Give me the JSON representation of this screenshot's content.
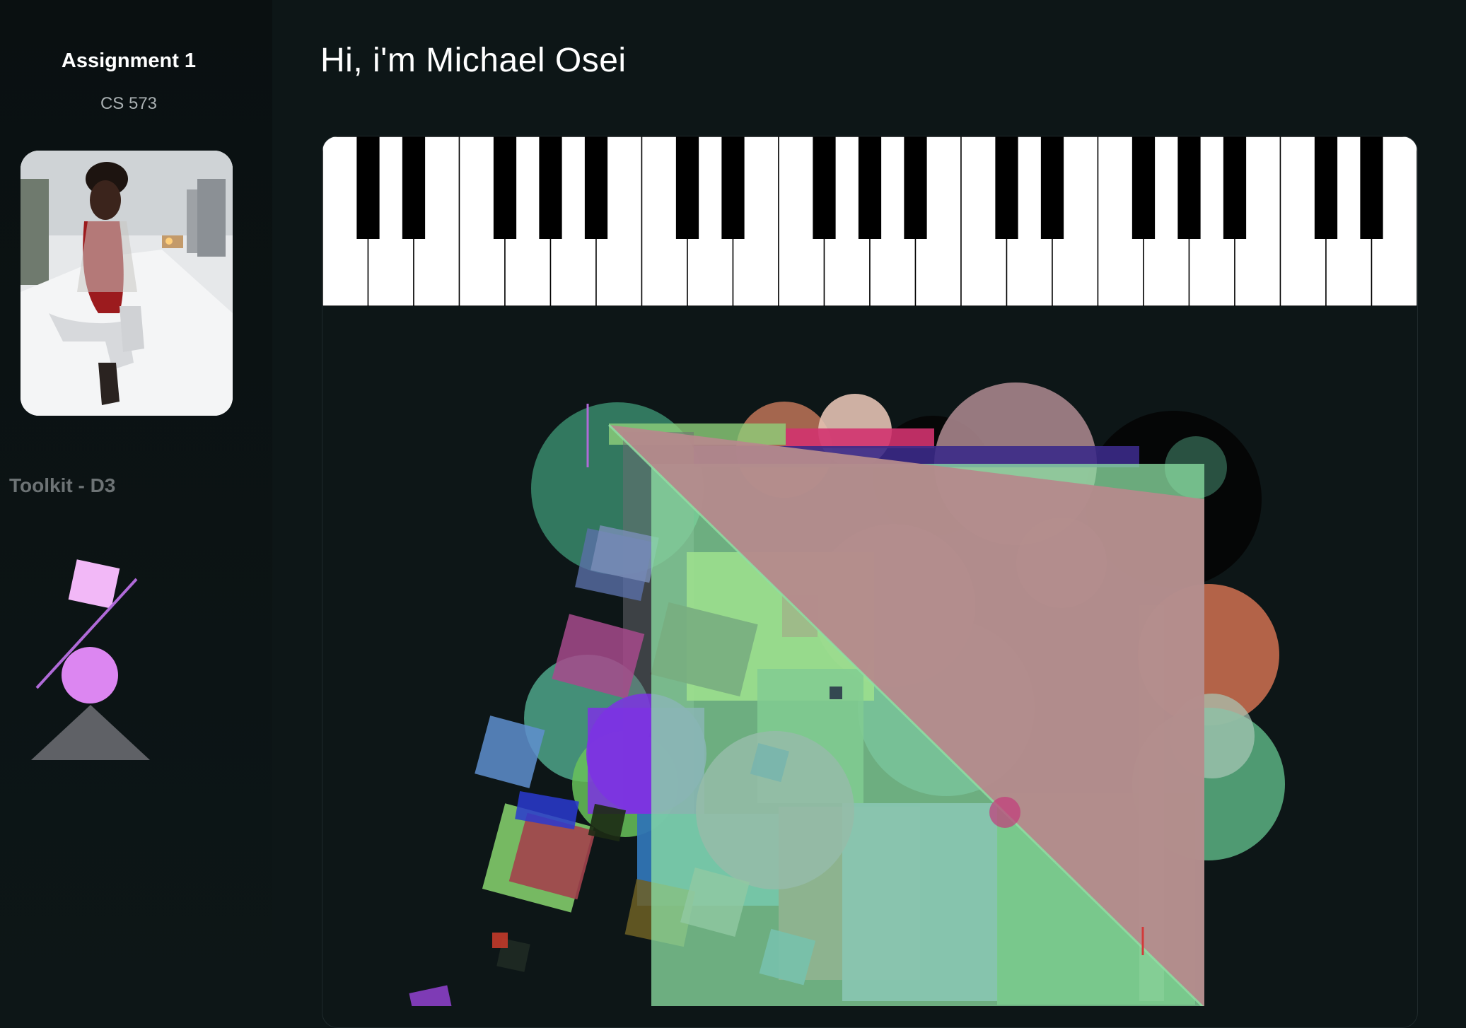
{
  "sidebar": {
    "title": "Assignment 1",
    "subtitle": "CS 573",
    "section_label": "Toolkit - D3"
  },
  "main": {
    "heading": "Hi, i'm Michael Osei"
  },
  "piano": {
    "white_key_count": 24,
    "white_key_color": "#ffffff",
    "black_key_color": "#000000"
  },
  "colors": {
    "background": "#0d1617",
    "logo_square": "#f2b8f7",
    "logo_line": "#b06ad8",
    "logo_circle": "#dc86f1",
    "logo_triangle": "#5f6166"
  }
}
